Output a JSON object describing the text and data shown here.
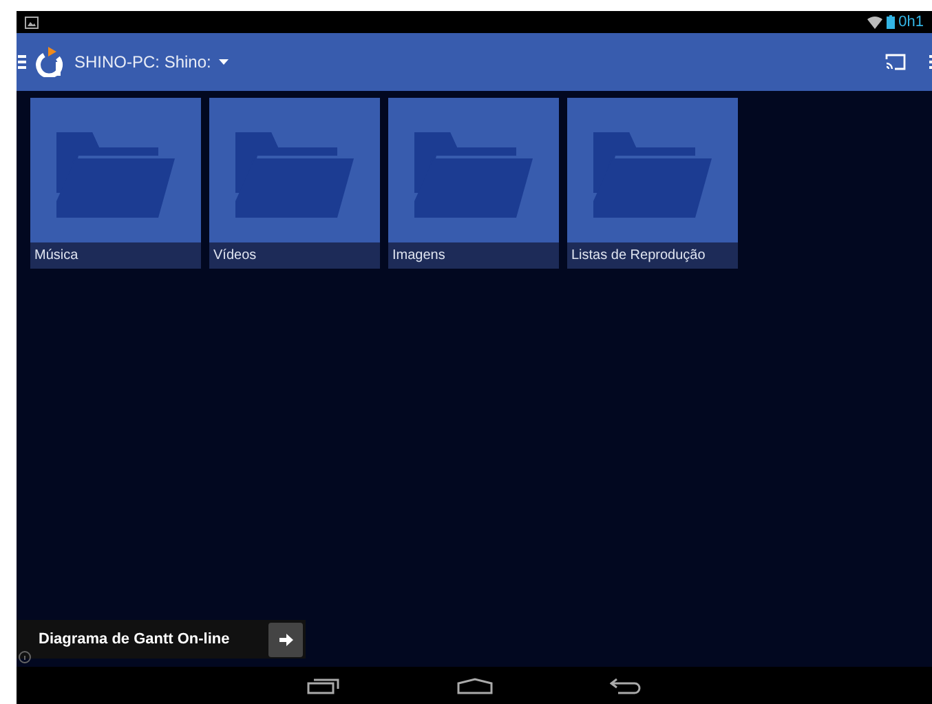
{
  "status_bar": {
    "time": "0h1"
  },
  "toolbar": {
    "title": "SHINO-PC: Shino:"
  },
  "folders": [
    {
      "label": "Música"
    },
    {
      "label": "Vídeos"
    },
    {
      "label": "Imagens"
    },
    {
      "label": "Listas de Reprodução"
    }
  ],
  "ad": {
    "text": "Diagrama de Gantt On-line"
  }
}
